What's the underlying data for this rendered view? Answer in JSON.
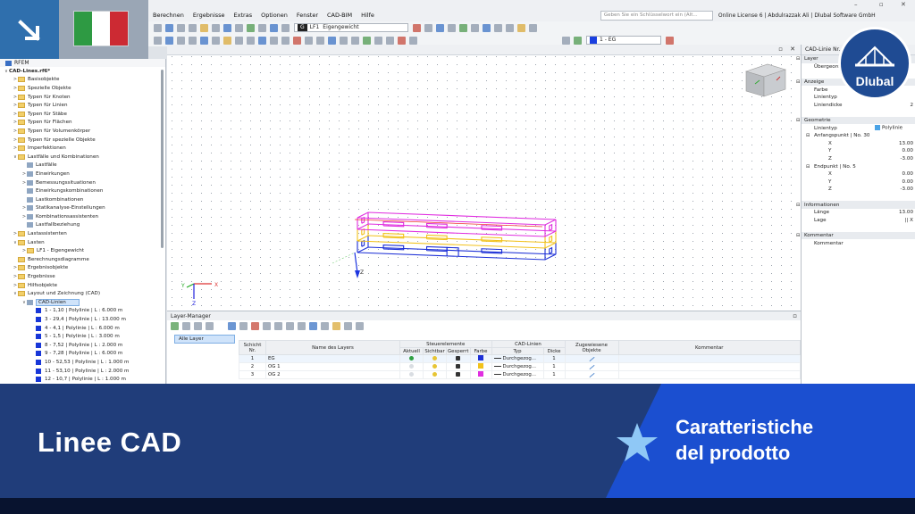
{
  "menu": [
    "Berechnen",
    "Ergebnisse",
    "Extras",
    "Optionen",
    "Fenster",
    "CAD-BIM",
    "Hilfe"
  ],
  "search_placeholder": "Geben Sie ein Schlüsselwort ein (Alt...",
  "license_text": "Online License 6 | Abdulrazzak Ali | Dlubal Software GmbH",
  "loadcase": {
    "tag": "G",
    "id": "LF1",
    "name": "Eigengewicht"
  },
  "layer_select": "1 - EG",
  "navigator": {
    "title": "RFEM",
    "items": [
      {
        "lvl": 0,
        "tw": "∨",
        "icon": "none",
        "label": "CAD-Lines.rf6*"
      },
      {
        "lvl": 1,
        "tw": ">",
        "icon": "folder",
        "label": "Basisobjekte"
      },
      {
        "lvl": 1,
        "tw": ">",
        "icon": "folder",
        "label": "Spezielle Objekte"
      },
      {
        "lvl": 1,
        "tw": ">",
        "icon": "folder",
        "label": "Typen für Knoten"
      },
      {
        "lvl": 1,
        "tw": ">",
        "icon": "folder",
        "label": "Typen für Linien"
      },
      {
        "lvl": 1,
        "tw": ">",
        "icon": "folder",
        "label": "Typen für Stäbe"
      },
      {
        "lvl": 1,
        "tw": ">",
        "icon": "folder",
        "label": "Typen für Flächen"
      },
      {
        "lvl": 1,
        "tw": ">",
        "icon": "folder",
        "label": "Typen für Volumenkörper"
      },
      {
        "lvl": 1,
        "tw": ">",
        "icon": "folder",
        "label": "Typen für spezielle Objekte"
      },
      {
        "lvl": 1,
        "tw": ">",
        "icon": "folder",
        "label": "Imperfektionen"
      },
      {
        "lvl": 1,
        "tw": "∨",
        "icon": "folder",
        "label": "Lastfälle und Kombinationen"
      },
      {
        "lvl": 2,
        "tw": "",
        "icon": "item",
        "label": "Lastfälle"
      },
      {
        "lvl": 2,
        "tw": ">",
        "icon": "item",
        "label": "Einwirkungen"
      },
      {
        "lvl": 2,
        "tw": ">",
        "icon": "item",
        "label": "Bemessungssituationen"
      },
      {
        "lvl": 2,
        "tw": "",
        "icon": "item",
        "label": "Einwirkungskombinationen"
      },
      {
        "lvl": 2,
        "tw": "",
        "icon": "item",
        "label": "Lastkombinationen"
      },
      {
        "lvl": 2,
        "tw": ">",
        "icon": "item",
        "label": "Statikanalyse-Einstellungen"
      },
      {
        "lvl": 2,
        "tw": ">",
        "icon": "item",
        "label": "Kombinationsassistenten"
      },
      {
        "lvl": 2,
        "tw": "",
        "icon": "item",
        "label": "Lastfallbeziehung"
      },
      {
        "lvl": 1,
        "tw": ">",
        "icon": "folder",
        "label": "Lastassistenten"
      },
      {
        "lvl": 1,
        "tw": "∨",
        "icon": "folder",
        "label": "Lasten"
      },
      {
        "lvl": 2,
        "tw": ">",
        "icon": "folder",
        "label": "LF1 - Eigengewicht"
      },
      {
        "lvl": 1,
        "tw": "",
        "icon": "folder",
        "label": "Berechnungsdiagramme"
      },
      {
        "lvl": 1,
        "tw": ">",
        "icon": "folder",
        "label": "Ergebnisobjekte"
      },
      {
        "lvl": 1,
        "tw": ">",
        "icon": "folder",
        "label": "Ergebnisse"
      },
      {
        "lvl": 1,
        "tw": ">",
        "icon": "folder",
        "label": "Hilfsobjekte"
      },
      {
        "lvl": 1,
        "tw": "∨",
        "icon": "folder",
        "label": "Layout und Zeichnung (CAD)"
      },
      {
        "lvl": 2,
        "tw": "∨",
        "icon": "item",
        "label": "CAD-Linien",
        "selected": true
      },
      {
        "lvl": 3,
        "tw": "",
        "icon": "blue",
        "label": "1 - 1,10 | Polylinie | L : 6.000 m"
      },
      {
        "lvl": 3,
        "tw": "",
        "icon": "blue",
        "label": "3 - 29,4 | Polylinie | L : 13.000 m"
      },
      {
        "lvl": 3,
        "tw": "",
        "icon": "blue",
        "label": "4 - 4,1 | Polylinie | L : 6.000 m"
      },
      {
        "lvl": 3,
        "tw": "",
        "icon": "blue",
        "label": "5 - 1,5 | Polylinie | L : 3.000 m"
      },
      {
        "lvl": 3,
        "tw": "",
        "icon": "blue",
        "label": "8 - 7,52 | Polylinie | L : 2.000 m"
      },
      {
        "lvl": 3,
        "tw": "",
        "icon": "blue",
        "label": "9 - 7,28 | Polylinie | L : 6.000 m"
      },
      {
        "lvl": 3,
        "tw": "",
        "icon": "blue",
        "label": "10 - 52,53 | Polylinie | L : 1.000 m"
      },
      {
        "lvl": 3,
        "tw": "",
        "icon": "blue",
        "label": "11 - 53,10 | Polylinie | L : 2.000 m"
      },
      {
        "lvl": 3,
        "tw": "",
        "icon": "blue",
        "label": "12 - 10,7 | Polylinie | L : 1.000 m"
      }
    ]
  },
  "properties": {
    "title": "CAD-Linie Nr. 52",
    "rows": [
      {
        "type": "sec",
        "label": "Layer",
        "value": ""
      },
      {
        "type": "row",
        "label": "Übergeord",
        "value": ""
      },
      {
        "type": "blank"
      },
      {
        "type": "sec",
        "label": "Anzeige",
        "value": ""
      },
      {
        "type": "row",
        "label": "Farbe",
        "value": ""
      },
      {
        "type": "row",
        "label": "Linientyp",
        "value": ""
      },
      {
        "type": "row",
        "label": "Liniendicke",
        "value": "2"
      },
      {
        "type": "blank"
      },
      {
        "type": "sec",
        "label": "Geometrie",
        "value": ""
      },
      {
        "type": "row",
        "label": "Linientyp",
        "value": "Polylinie",
        "swatch": true
      },
      {
        "type": "sub",
        "label": "Anfangspunkt | No. 30",
        "value": ""
      },
      {
        "type": "row2",
        "label": "X",
        "value": "13.00"
      },
      {
        "type": "row2",
        "label": "Y",
        "value": "0.00"
      },
      {
        "type": "row2",
        "label": "Z",
        "value": "-3.00"
      },
      {
        "type": "sub",
        "label": "Endpunkt | No. 5",
        "value": ""
      },
      {
        "type": "row2",
        "label": "X",
        "value": "0.00"
      },
      {
        "type": "row2",
        "label": "Y",
        "value": "0.00"
      },
      {
        "type": "row2",
        "label": "Z",
        "value": "-3.00"
      },
      {
        "type": "blank"
      },
      {
        "type": "sec",
        "label": "Informationen",
        "value": ""
      },
      {
        "type": "row",
        "label": "Länge",
        "value": "13.00"
      },
      {
        "type": "row",
        "label": "Lage",
        "value": "|| X"
      },
      {
        "type": "blank"
      },
      {
        "type": "sec",
        "label": "Kommentar",
        "value": ""
      },
      {
        "type": "row",
        "label": "Kommentar",
        "value": ""
      }
    ]
  },
  "layer_manager": {
    "title": "Layer-Manager",
    "all_layers": "Alle Layer",
    "headers": {
      "nr": "Schicht Nr.",
      "name": "Name des Layers",
      "group_steuer": "Steuerelemente",
      "aktuell": "Aktuell",
      "sichtbar": "Sichtbar",
      "gesperrt": "Gesperrt",
      "farbe": "Farbe",
      "group_cad": "CAD-Linien",
      "typ": "Typ",
      "dicke": "Dicke",
      "objekte": "Zugewiesene Objekte",
      "kommentar": "Kommentar"
    },
    "rows": [
      {
        "nr": "1",
        "name": "EG",
        "color": "#1c2fd6",
        "typ": "Durchgezog...",
        "dicke": "1",
        "current": true
      },
      {
        "nr": "2",
        "name": "OG 1",
        "color": "#f2c21b",
        "typ": "Durchgezog...",
        "dicke": "1",
        "current": false
      },
      {
        "nr": "3",
        "name": "OG 2",
        "color": "#e02ee0",
        "typ": "Durchgezog...",
        "dicke": "1",
        "current": false
      }
    ]
  },
  "banner": {
    "title": "Linee CAD",
    "feature_line1": "Caratteristiche",
    "feature_line2": "del prodotto",
    "logo_text": "Dlubal"
  },
  "colors": {
    "eg": "#1c2fd6",
    "og1": "#f2c21b",
    "og2": "#e02ee0",
    "banner": "#203d7a",
    "accent": "#1b4fd0"
  },
  "axes": {
    "x": "X",
    "y": "Y",
    "z": "Z"
  }
}
